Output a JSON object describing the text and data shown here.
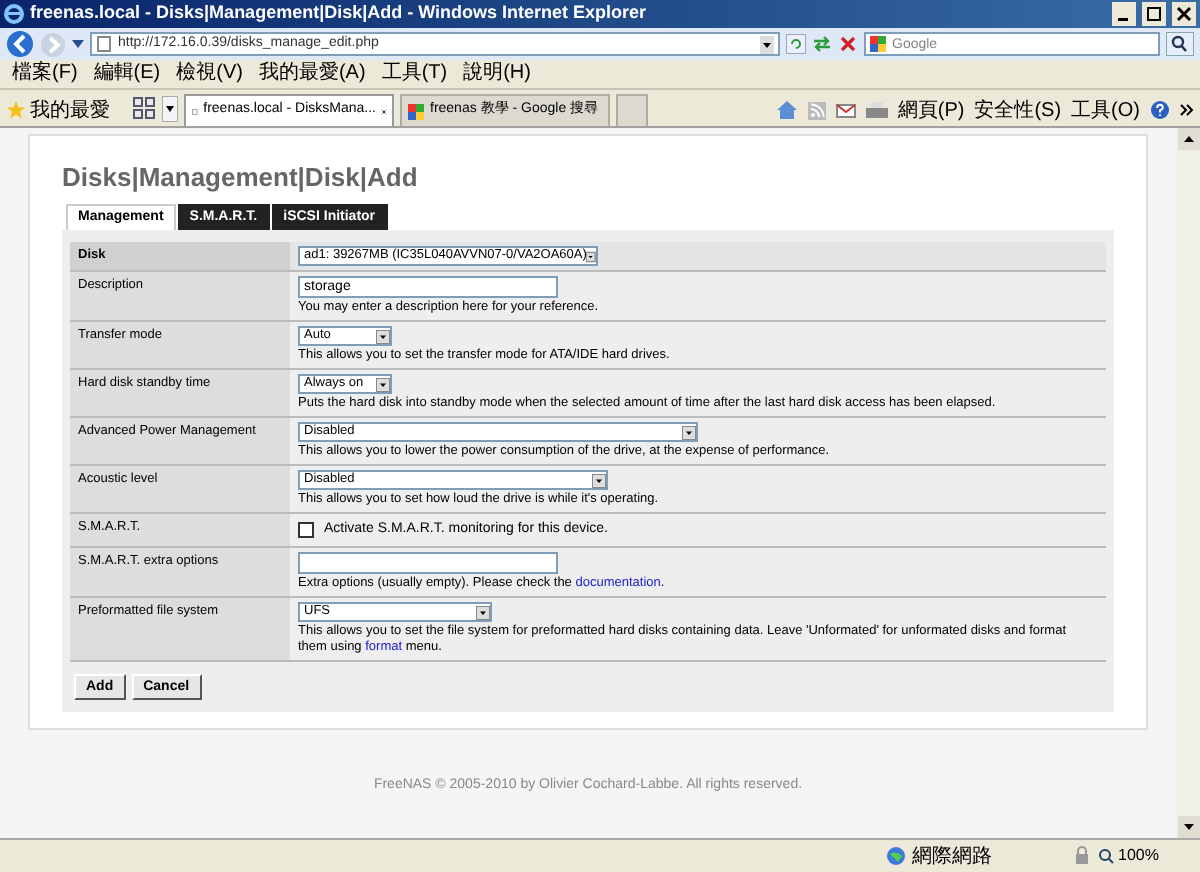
{
  "window": {
    "title": "freenas.local - Disks|Management|Disk|Add - Windows Internet Explorer"
  },
  "address_bar": {
    "url": "http://172.16.0.39/disks_manage_edit.php"
  },
  "search": {
    "placeholder": "Google"
  },
  "menu": [
    "檔案(F)",
    "編輯(E)",
    "檢視(V)",
    "我的最愛(A)",
    "工具(T)",
    "說明(H)"
  ],
  "favorites": {
    "label": "我的最愛"
  },
  "browser_tabs": [
    {
      "label": "freenas.local - DisksMana...",
      "selected": true
    },
    {
      "label": "freenas 教學 - Google 搜尋",
      "selected": false
    }
  ],
  "command_bar": [
    "網頁(P)",
    "安全性(S)",
    "工具(O)"
  ],
  "page": {
    "heading": "Disks|Management|Disk|Add",
    "tabs": [
      {
        "label": "Management",
        "selected": true
      },
      {
        "label": "S.M.A.R.T.",
        "selected": false
      },
      {
        "label": "iSCSI Initiator",
        "selected": false
      }
    ],
    "rows": [
      {
        "kind": "select",
        "label": "Disk",
        "header": true,
        "value": "ad1: 39267MB (IC35L040AVVN07-0/VA2OA60A)"
      },
      {
        "kind": "text",
        "label": "Description",
        "header": false,
        "value": "storage",
        "hint": [
          {
            "text": "You may enter a description here for your reference.",
            "link": false
          }
        ]
      },
      {
        "kind": "select",
        "label": "Transfer mode",
        "header": false,
        "value": "Auto",
        "hint": [
          {
            "text": "This allows you to set the transfer mode for ATA/IDE hard drives.",
            "link": false
          }
        ]
      },
      {
        "kind": "select",
        "label": "Hard disk standby time",
        "header": false,
        "value": "Always on",
        "hint": [
          {
            "text": "Puts the hard disk into standby mode when the selected amount of time after the last hard disk access has been elapsed.",
            "link": false
          }
        ]
      },
      {
        "kind": "select",
        "label": "Advanced Power Management",
        "header": false,
        "value": "Disabled",
        "hint": [
          {
            "text": "This allows you to lower the power consumption of the drive, at the expense of performance.",
            "link": false
          }
        ]
      },
      {
        "kind": "select",
        "label": "Acoustic level",
        "header": false,
        "value": "Disabled",
        "hint": [
          {
            "text": "This allows you to set how loud the drive is while it's operating.",
            "link": false
          }
        ]
      },
      {
        "kind": "checkbox",
        "label": "S.M.A.R.T.",
        "header": false,
        "checked": false,
        "text": "Activate S.M.A.R.T. monitoring for this device."
      },
      {
        "kind": "text",
        "label": "S.M.A.R.T. extra options",
        "header": false,
        "hint": [
          {
            "text": "Extra options (usually empty). Please check the ",
            "link": false
          },
          {
            "text": "documentation",
            "link": true
          },
          {
            "text": ".",
            "link": false
          }
        ]
      },
      {
        "kind": "select",
        "label": "Preformatted file system",
        "header": false,
        "value": "UFS",
        "hint": [
          {
            "text": "This allows you to set the file system for preformatted hard disks containing data. Leave 'Unformated' for unformated disks and format them using ",
            "link": false
          },
          {
            "text": "format",
            "link": true
          },
          {
            "text": " menu.",
            "link": false
          }
        ]
      }
    ],
    "buttons": [
      "Add",
      "Cancel"
    ],
    "footer": "FreeNAS © 2005-2010 by Olivier Cochard-Labbe. All rights reserved."
  },
  "status_bar": {
    "zone": "網際網路",
    "zoom": "100%"
  }
}
